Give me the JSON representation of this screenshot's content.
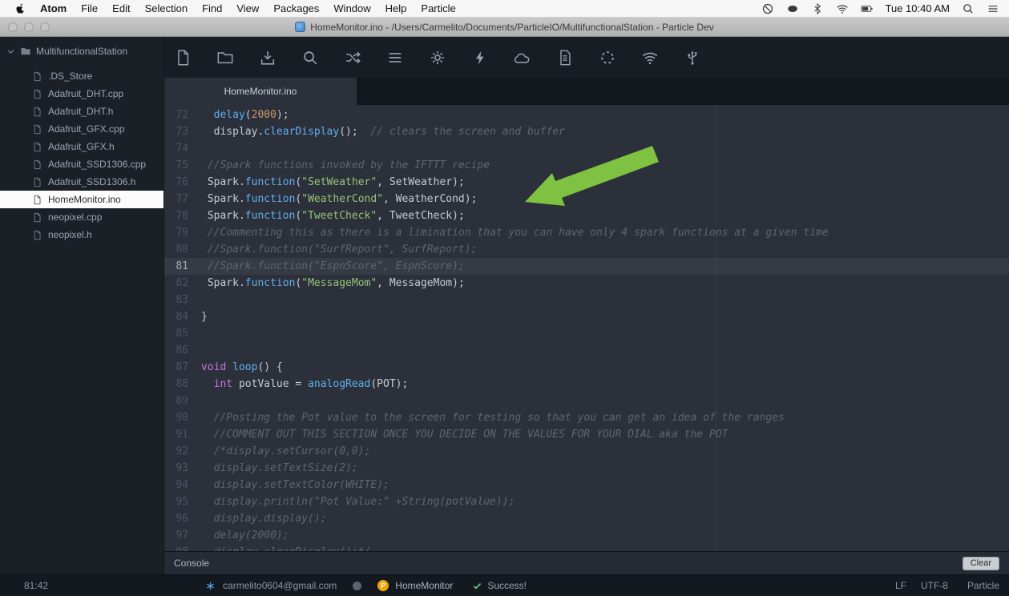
{
  "menubar": {
    "items": [
      "Atom",
      "File",
      "Edit",
      "Selection",
      "Find",
      "View",
      "Packages",
      "Window",
      "Help",
      "Particle"
    ],
    "status_icons": [
      "do-not-disturb-icon",
      "oval-indicator-icon",
      "bluetooth-icon",
      "wifi-icon",
      "battery-icon"
    ],
    "clock": "Tue 10:40 AM",
    "right_icons": [
      "spotlight-icon",
      "notification-center-icon"
    ]
  },
  "titlebar": {
    "title": "HomeMonitor.ino - /Users/Carmelito/Documents/ParticleIO/MultifunctionalStation - Particle Dev"
  },
  "sidebar": {
    "root_label": "MultifunctionalStation",
    "files": [
      {
        "name": ".DS_Store"
      },
      {
        "name": "Adafruit_DHT.cpp"
      },
      {
        "name": "Adafruit_DHT.h"
      },
      {
        "name": "Adafruit_GFX.cpp"
      },
      {
        "name": "Adafruit_GFX.h"
      },
      {
        "name": "Adafruit_SSD1306.cpp"
      },
      {
        "name": "Adafruit_SSD1306.h"
      },
      {
        "name": "HomeMonitor.ino",
        "selected": true
      },
      {
        "name": "neopixel.cpp"
      },
      {
        "name": "neopixel.h"
      }
    ]
  },
  "toolbar": {
    "icons": [
      "new-file-icon",
      "open-folder-icon",
      "save-icon",
      "search-icon",
      "compile-icon",
      "panel-list-icon",
      "settings-gear-icon",
      "flash-icon",
      "cloud-icon",
      "log-icon",
      "spinner-icon",
      "wifi-icon-toolbar",
      "serial-usb-icon"
    ]
  },
  "tabs": [
    {
      "label": "HomeMonitor.ino",
      "active": true
    }
  ],
  "editor": {
    "lines": [
      {
        "n": 72,
        "seg": [
          [
            "t",
            "  "
          ],
          [
            "fn",
            "delay"
          ],
          [
            "t",
            "("
          ],
          [
            "num",
            "2000"
          ],
          [
            "t",
            ");"
          ]
        ]
      },
      {
        "n": 73,
        "seg": [
          [
            "t",
            "  display."
          ],
          [
            "fn",
            "clearDisplay"
          ],
          [
            "t",
            "();  "
          ],
          [
            "cm",
            "// clears the screen and buffer"
          ]
        ]
      },
      {
        "n": 74,
        "seg": []
      },
      {
        "n": 75,
        "seg": [
          [
            "t",
            " "
          ],
          [
            "cm",
            "//Spark functions invoked by the IFTTT recipe"
          ]
        ]
      },
      {
        "n": 76,
        "seg": [
          [
            "t",
            " Spark."
          ],
          [
            "fn",
            "function"
          ],
          [
            "t",
            "("
          ],
          [
            "str",
            "\"SetWeather\""
          ],
          [
            "t",
            ", SetWeather);"
          ]
        ]
      },
      {
        "n": 77,
        "seg": [
          [
            "t",
            " Spark."
          ],
          [
            "fn",
            "function"
          ],
          [
            "t",
            "("
          ],
          [
            "str",
            "\"WeatherCond\""
          ],
          [
            "t",
            ", WeatherCond);"
          ]
        ]
      },
      {
        "n": 78,
        "seg": [
          [
            "t",
            " Spark."
          ],
          [
            "fn",
            "function"
          ],
          [
            "t",
            "("
          ],
          [
            "str",
            "\"TweetCheck\""
          ],
          [
            "t",
            ", TweetCheck);"
          ]
        ]
      },
      {
        "n": 79,
        "seg": [
          [
            "t",
            " "
          ],
          [
            "cm",
            "//Commenting this as there is a limination that you can have only 4 spark functions at a given time"
          ]
        ]
      },
      {
        "n": 80,
        "seg": [
          [
            "t",
            " "
          ],
          [
            "cm",
            "//Spark.function(\"SurfReport\", SurfReport);"
          ]
        ]
      },
      {
        "n": 81,
        "active": true,
        "seg": [
          [
            "t",
            " "
          ],
          [
            "cm",
            "//Spark.function(\"EspnScore\", EspnScore);"
          ]
        ]
      },
      {
        "n": 82,
        "seg": [
          [
            "t",
            " Spark."
          ],
          [
            "fn",
            "function"
          ],
          [
            "t",
            "("
          ],
          [
            "str",
            "\"MessageMom\""
          ],
          [
            "t",
            ", MessageMom);"
          ]
        ]
      },
      {
        "n": 83,
        "seg": []
      },
      {
        "n": 84,
        "seg": [
          [
            "t",
            "}"
          ]
        ]
      },
      {
        "n": 85,
        "seg": []
      },
      {
        "n": 86,
        "seg": []
      },
      {
        "n": 87,
        "seg": [
          [
            "kw",
            "void"
          ],
          [
            "t",
            " "
          ],
          [
            "fn",
            "loop"
          ],
          [
            "t",
            "() {"
          ]
        ]
      },
      {
        "n": 88,
        "seg": [
          [
            "t",
            "  "
          ],
          [
            "kw",
            "int"
          ],
          [
            "t",
            " potValue = "
          ],
          [
            "fn",
            "analogRead"
          ],
          [
            "t",
            "(POT);"
          ]
        ]
      },
      {
        "n": 89,
        "seg": []
      },
      {
        "n": 90,
        "seg": [
          [
            "t",
            "  "
          ],
          [
            "cm",
            "//Posting the Pot value to the screen for testing so that you can get an idea of the ranges"
          ]
        ]
      },
      {
        "n": 91,
        "seg": [
          [
            "t",
            "  "
          ],
          [
            "cm",
            "//COMMENT OUT THIS SECTION ONCE YOU DECIDE ON THE VALUES FOR YOUR DIAL aka the POT"
          ]
        ]
      },
      {
        "n": 92,
        "seg": [
          [
            "t",
            "  "
          ],
          [
            "cm",
            "/*display.setCursor(0,0);"
          ]
        ]
      },
      {
        "n": 93,
        "seg": [
          [
            "t",
            "  "
          ],
          [
            "cm",
            "display.setTextSize(2);"
          ]
        ]
      },
      {
        "n": 94,
        "seg": [
          [
            "t",
            "  "
          ],
          [
            "cm",
            "display.setTextColor(WHITE);"
          ]
        ]
      },
      {
        "n": 95,
        "seg": [
          [
            "t",
            "  "
          ],
          [
            "cm",
            "display.println(\"Pot Value:\" +String(potValue));"
          ]
        ]
      },
      {
        "n": 96,
        "seg": [
          [
            "t",
            "  "
          ],
          [
            "cm",
            "display.display();"
          ]
        ]
      },
      {
        "n": 97,
        "seg": [
          [
            "t",
            "  "
          ],
          [
            "cm",
            "delay(2000);"
          ]
        ]
      },
      {
        "n": 98,
        "seg": [
          [
            "t",
            "  "
          ],
          [
            "cm",
            "display.clearDisplay();*/"
          ]
        ]
      }
    ]
  },
  "console": {
    "title": "Console",
    "clear_label": "Clear"
  },
  "statusbar": {
    "cursor_position": "81:42",
    "icons": [
      "sync-asterisk-icon",
      "offline-dot-icon",
      "project-badge",
      "success-check-icon"
    ],
    "email": "carmelito0604@gmail.com",
    "project_badge": "P",
    "project": "HomeMonitor",
    "status": "Success!",
    "line_ending": "LF",
    "encoding": "UTF-8",
    "mode": "Particle"
  },
  "colors": {
    "arrow": "#7fc241",
    "accent_blue": "#61afef",
    "string_green": "#98c379",
    "number_orange": "#d19a66",
    "keyword_purple": "#c678dd",
    "comment_gray": "#5f6672"
  }
}
